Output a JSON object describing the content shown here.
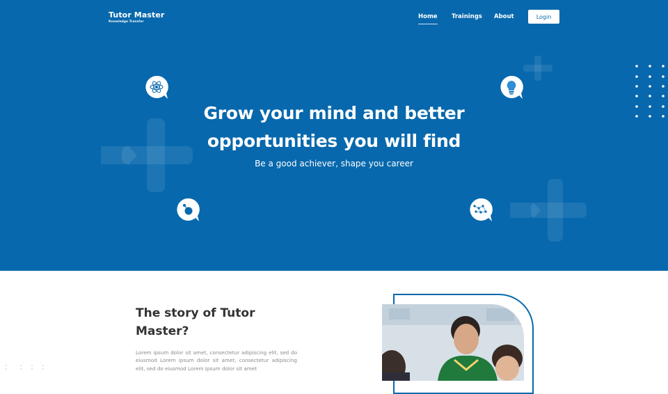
{
  "brand": {
    "title": "Tutor Master",
    "subtitle": "Knowledge Transfer"
  },
  "nav": {
    "items": [
      {
        "label": "Home",
        "active": true
      },
      {
        "label": "Trainings",
        "active": false
      },
      {
        "label": "About",
        "active": false
      }
    ],
    "login_label": "Login"
  },
  "hero": {
    "title_line1": "Grow your mind and better",
    "title_line2": "opportunities you will find",
    "subtitle": "Be a good achiever, shape you career"
  },
  "story": {
    "title": "The story of Tutor Master?",
    "body": "Lorem ipsum dolor sit amet, consectetur adipiscing elit, sed do eiusmod Lorem ipsum dolor sit amet, consectetur adipiscing elit, sed do eiusmod Lorem ipsum dolor sit amet"
  },
  "icons": [
    "atom-icon",
    "lightbulb-icon",
    "molecule-icon",
    "network-icon"
  ],
  "colors": {
    "primary": "#0768ad",
    "white": "#ffffff",
    "heading": "#333333",
    "body_text": "#8a8a8a"
  }
}
